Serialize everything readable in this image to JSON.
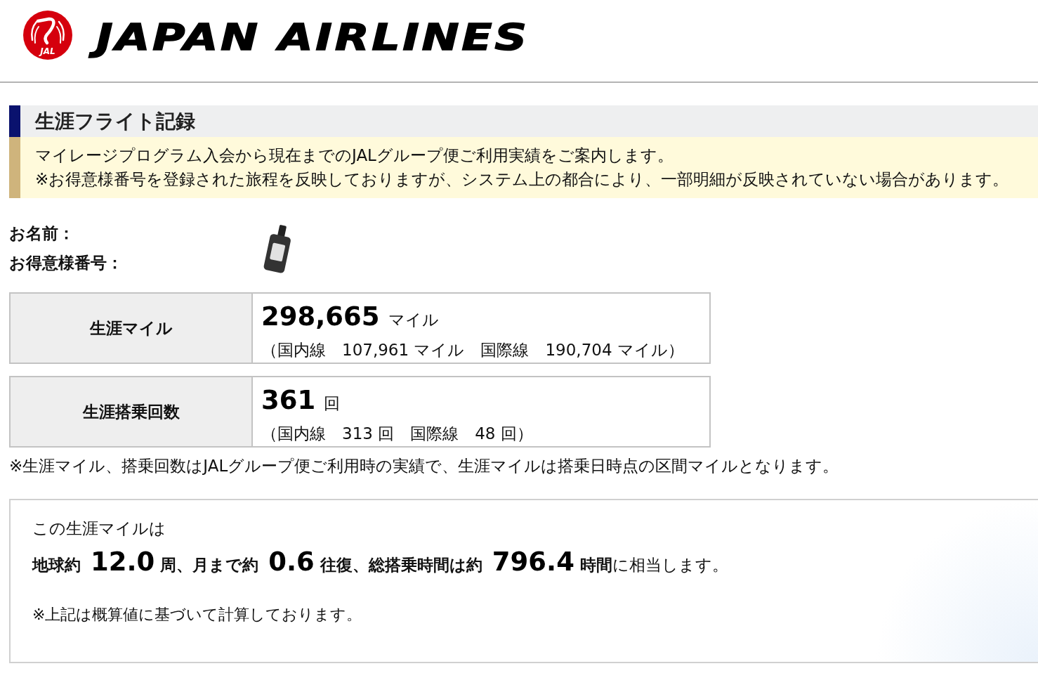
{
  "header": {
    "emblem_text": "JAL",
    "wordmark": "JAPAN AIRLINES"
  },
  "section": {
    "title": "生涯フライト記録",
    "notice": [
      "マイレージプログラム入会から現在までのJALグループ便ご利用実績をご案内します。",
      "※お得意様番号を登録された旅程を反映しておりますが、システム上の都合により、一部明細が反映されていない場合があります。"
    ]
  },
  "member": {
    "labels": [
      "お名前：",
      "お得意様番号："
    ]
  },
  "stats": [
    {
      "label": "生涯マイル",
      "total": "298,665",
      "unit": "マイル",
      "breakdown": "（国内線　107,961 マイル　国際線　190,704 マイル）"
    },
    {
      "label": "生涯搭乗回数",
      "total": "361",
      "unit": "回",
      "breakdown": "（国内線　313 回　国際線　48 回）"
    }
  ],
  "stats_note": "※生涯マイル、搭乗回数はJALグループ便ご利用時の実績で、生涯マイルは搭乗日時点の区間マイルとなります。",
  "summary": {
    "intro": "この生涯マイルは",
    "equivalents": [
      {
        "kind": "label",
        "text": "地球約"
      },
      {
        "kind": "number",
        "text": "12.0"
      },
      {
        "kind": "label",
        "text": "周、月まで約"
      },
      {
        "kind": "number",
        "text": "0.6"
      },
      {
        "kind": "label",
        "text": "往復、総搭乗時間は約"
      },
      {
        "kind": "number",
        "text": "796.4"
      },
      {
        "kind": "text",
        "text": "**時間**に相当します。"
      }
    ],
    "note": "※上記は概算値に基づいて計算しております。"
  }
}
